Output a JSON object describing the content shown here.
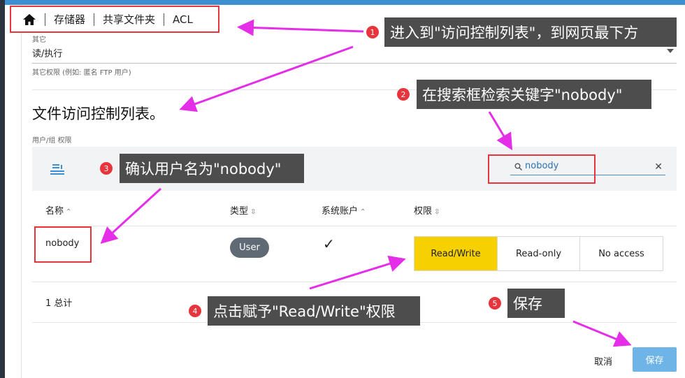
{
  "breadcrumb": {
    "home_icon": "home-icon",
    "items": [
      "存储器",
      "共享文件夹",
      "ACL"
    ]
  },
  "others": {
    "label": "其它",
    "value": "读/执行",
    "hint": "其它权限 (例如: 匿名 FTP 用户)"
  },
  "acl": {
    "title": "文件访问控制列表。",
    "subtitle": "用户/组 权限",
    "search_value": "nobody",
    "columns": [
      "名称",
      "类型",
      "系统账户",
      "权限"
    ],
    "row": {
      "name": "nobody",
      "type": "User",
      "system_account": "✓",
      "permissions": [
        "Read/Write",
        "Read-only",
        "No access"
      ],
      "selected_permission": "Read/Write"
    },
    "total": "1 总计"
  },
  "footer": {
    "cancel": "取消",
    "save": "保存"
  },
  "annotations": [
    {
      "num": "1",
      "text": "进入到\"访问控制列表\"，到网页最下方"
    },
    {
      "num": "2",
      "text": "在搜索框检索关键字\"nobody\""
    },
    {
      "num": "3",
      "text": "确认用户名为\"nobody\""
    },
    {
      "num": "4",
      "text": "点击赋予\"Read/Write\"权限"
    },
    {
      "num": "5",
      "text": "保存"
    }
  ],
  "colors": {
    "accent": "#3c8fd0",
    "highlight": "#e8343c",
    "selected": "#f7d000",
    "arrow": "#e42ee8",
    "callout": "#4d4d4d"
  }
}
